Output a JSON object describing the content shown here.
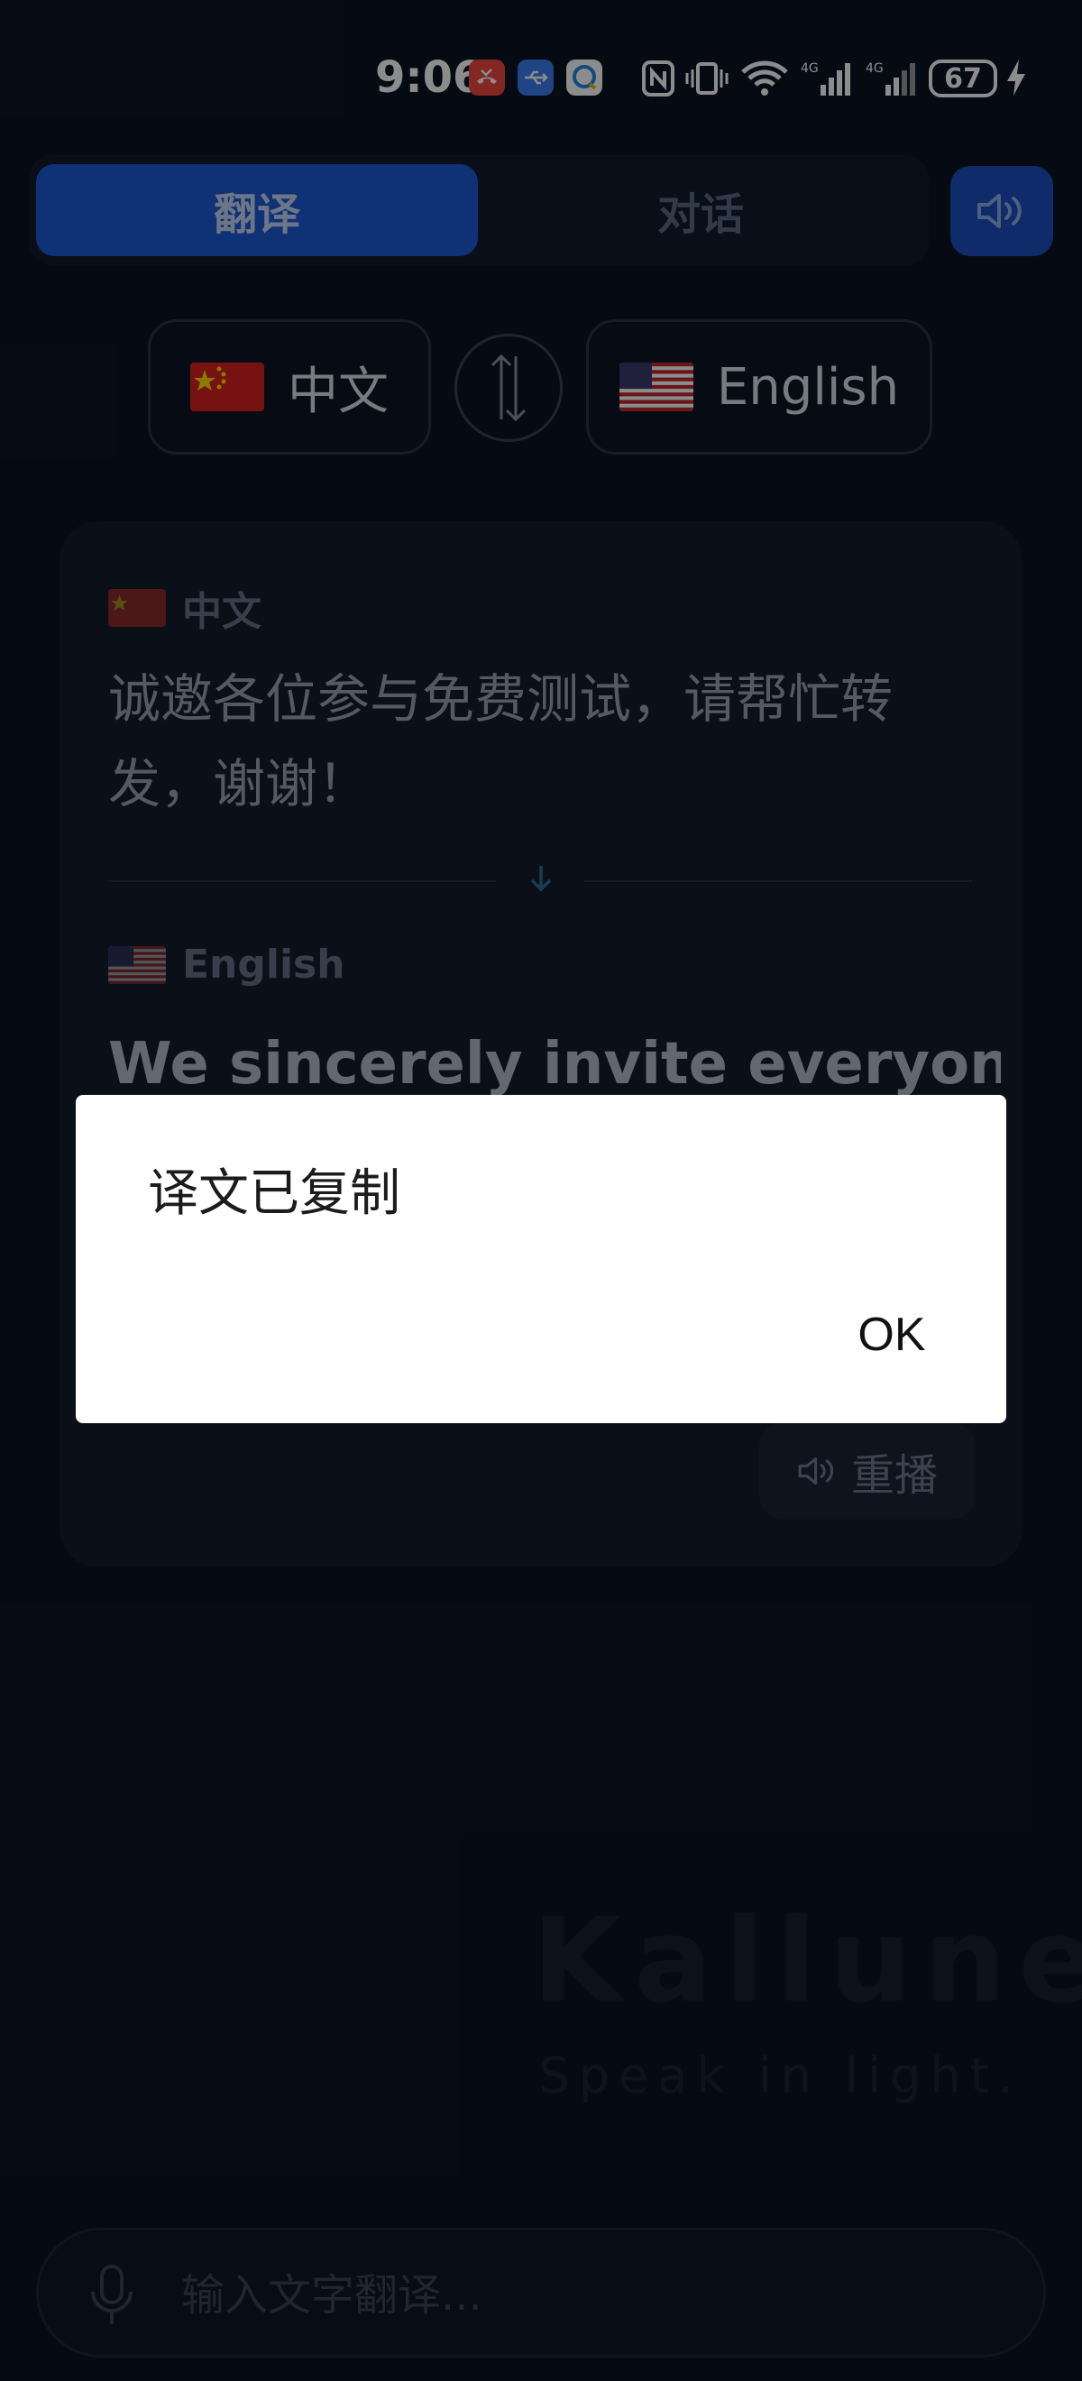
{
  "status_bar": {
    "time": "9:06",
    "battery": "67",
    "icons": [
      "missed-call-icon",
      "usb-icon",
      "chat-app-icon",
      "nfc-icon",
      "vibrate-icon",
      "wifi-icon",
      "signal-4g-icon",
      "signal-4g-icon",
      "charging-icon"
    ]
  },
  "mode_toggle": {
    "translate_label": "翻译",
    "dialogue_label": "对话"
  },
  "languages": {
    "source_name": "中文",
    "target_name": "English"
  },
  "card": {
    "source_label": "中文",
    "source_text": "诚邀各位参与免费测试，请帮忙转发，谢谢！",
    "target_label": "English",
    "target_text": "We sincerely invite everyone",
    "replay_label": "重播"
  },
  "brand": {
    "name": "Kallune",
    "tagline": "Speak in light."
  },
  "input": {
    "placeholder": "输入文字翻译..."
  },
  "dialog": {
    "message": "译文已复制",
    "ok_label": "OK"
  },
  "colors": {
    "background": "#0c1423",
    "accent": "#1d5ad8",
    "card": "#131c2c"
  }
}
